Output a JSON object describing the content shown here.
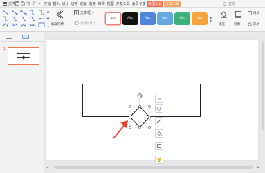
{
  "menubar": {
    "file_label": "文件",
    "tabs": [
      "开始",
      "插入",
      "设计",
      "切换",
      "动画",
      "放映",
      "审阅",
      "视图",
      "开发工具",
      "会员专享"
    ],
    "context_tabs": [
      "绘图工具",
      "文本工具"
    ],
    "search_label": "查找"
  },
  "ribbon": {
    "edit_shape_label": "编辑形状",
    "textbox_label": "文本框",
    "merge_shape_label": "合并形状",
    "style_presets": [
      "Abc",
      "Abc",
      "Abc",
      "Abc",
      "Abc",
      "Abc"
    ],
    "fill_label": "填充",
    "outline_label": "轮廓",
    "style_label": "样式",
    "effect_label": "形状"
  },
  "slides": {
    "items": [
      {
        "number": "1"
      }
    ]
  },
  "colors": {
    "context_tab_draw": "#ee6a4c",
    "context_tab_text": "#f3a05c",
    "selected_thumb_border": "#e8763e",
    "annotation_arrow": "#e23b2e"
  }
}
